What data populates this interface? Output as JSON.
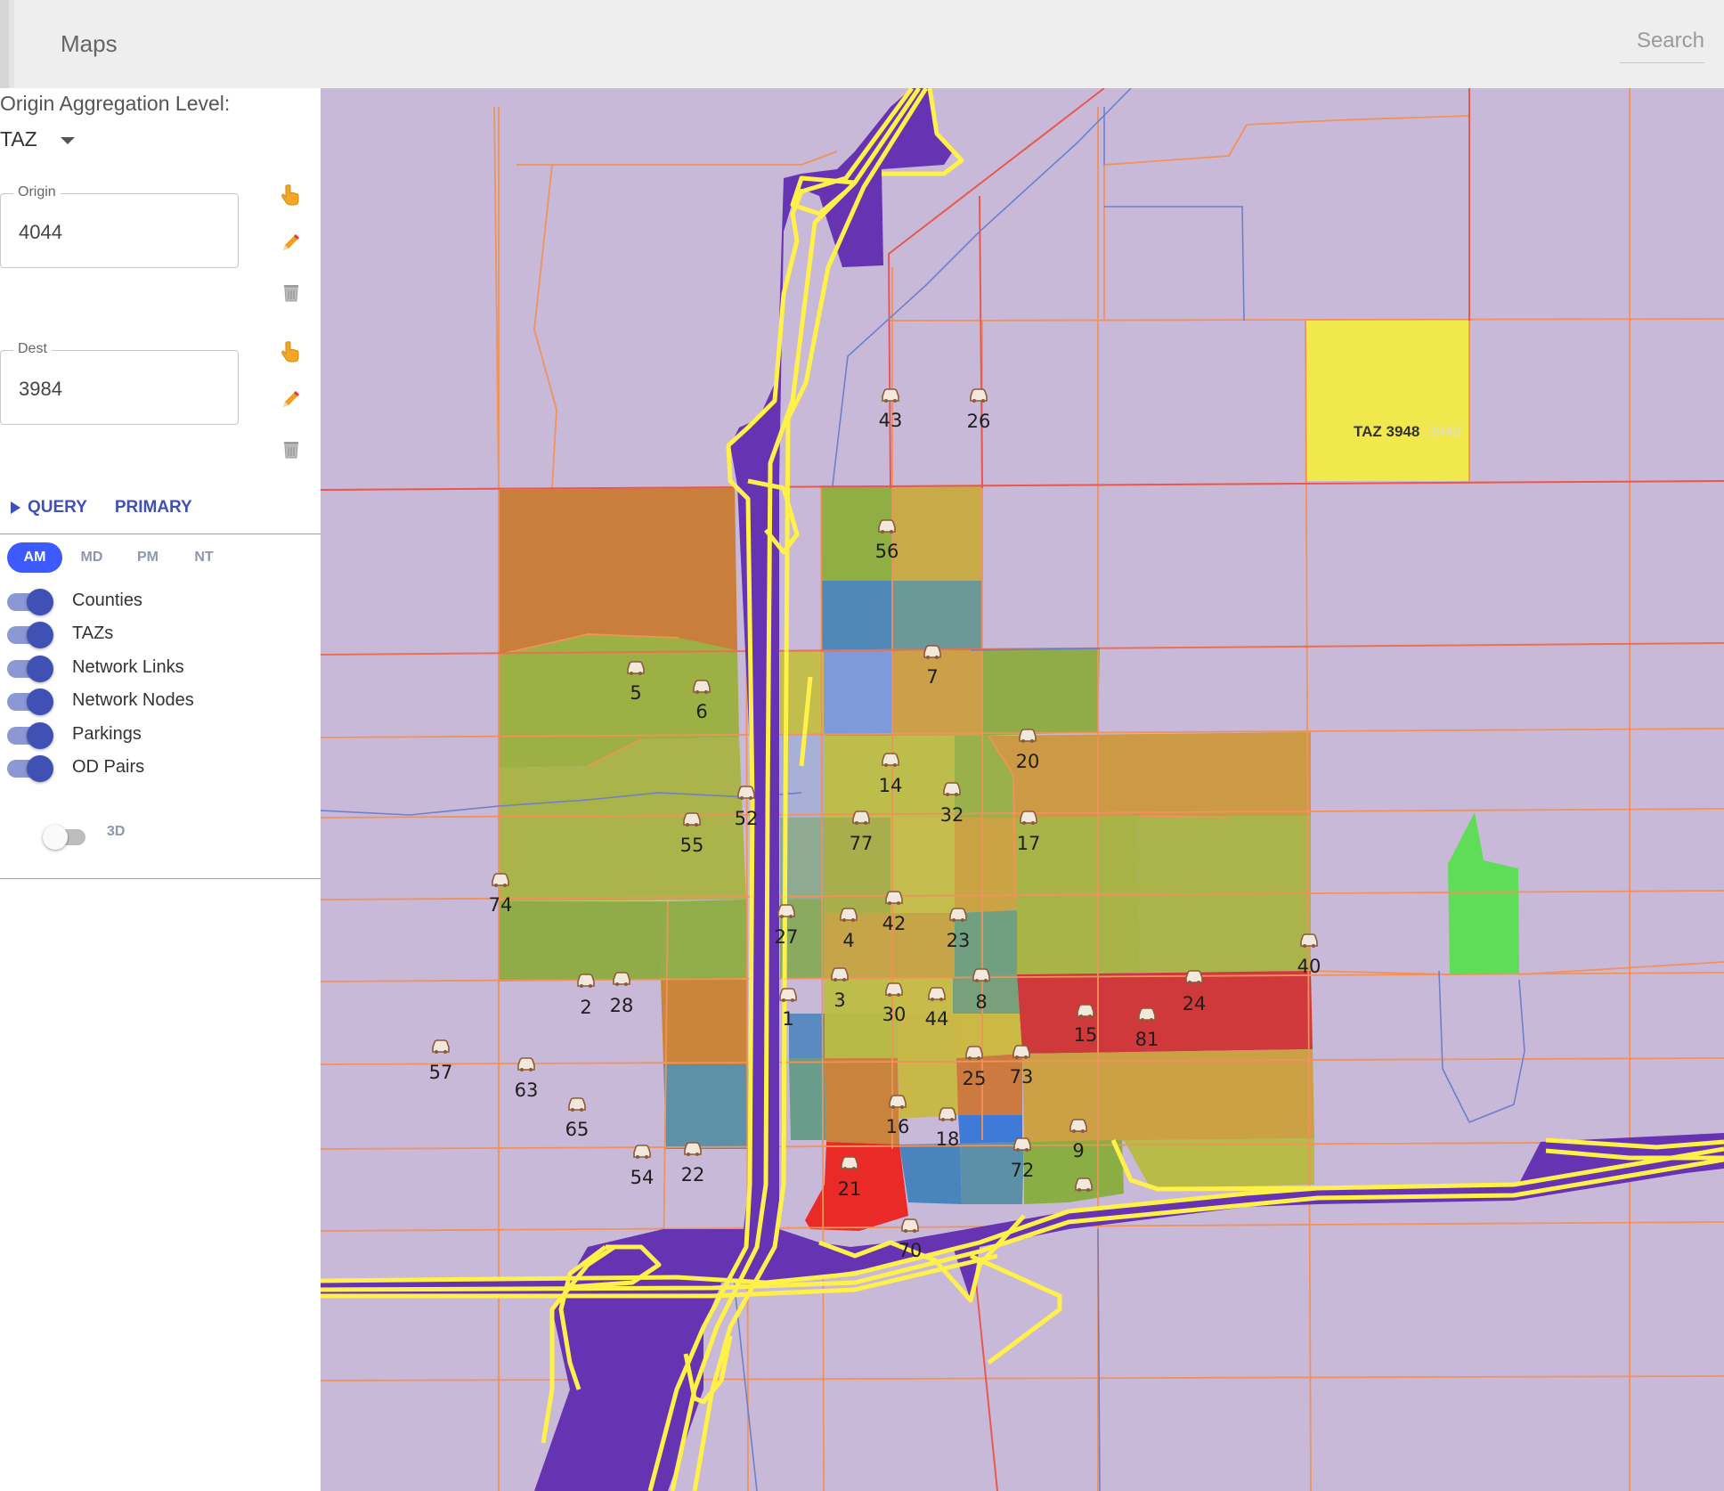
{
  "app": {
    "title": "Maps",
    "search_placeholder": "Search"
  },
  "panel": {
    "aggregation_label": "Origin Aggregation Level:",
    "aggregation_value": "TAZ",
    "origin": {
      "legend": "Origin",
      "value": "4044"
    },
    "dest": {
      "legend": "Dest",
      "value": "3984"
    },
    "query_label": "QUERY",
    "primary_label": "PRIMARY",
    "periods": [
      {
        "label": "AM",
        "active": true
      },
      {
        "label": "MD",
        "active": false
      },
      {
        "label": "PM",
        "active": false
      },
      {
        "label": "NT",
        "active": false
      }
    ],
    "layers": [
      {
        "label": "Counties",
        "on": true
      },
      {
        "label": "TAZs",
        "on": true
      },
      {
        "label": "Network Links",
        "on": true
      },
      {
        "label": "Network Nodes",
        "on": true
      },
      {
        "label": "Parkings",
        "on": true
      },
      {
        "label": "OD Pairs",
        "on": true
      }
    ],
    "toggle_3d": {
      "label": "3D",
      "on": false
    },
    "icons": [
      "hand-pointer-icon",
      "pencil-icon",
      "trash-icon"
    ]
  },
  "map": {
    "taz_label": "TAZ 3948",
    "taz_label_ghost": "3948",
    "parkings": [
      "43",
      "26",
      "56",
      "7",
      "5",
      "6",
      "20",
      "14",
      "32",
      "52",
      "55",
      "77",
      "17",
      "74",
      "27",
      "4",
      "42",
      "23",
      "40",
      "2",
      "28",
      "3",
      "30",
      "44",
      "8",
      "24",
      "1",
      "15",
      "81",
      "57",
      "63",
      "25",
      "73",
      "65",
      "16",
      "18",
      "9",
      "54",
      "22",
      "72",
      "21",
      "70"
    ],
    "colors": {
      "background": "#c9b9d9",
      "highway": "#fff04a",
      "highway_fill": "#6633b3",
      "taz_border": "#f0925a",
      "county_line": "#e8584e",
      "network_link": "#6f7fc8",
      "selected_taz": "#f0e84c",
      "green_zone": "#5fdc58"
    }
  }
}
